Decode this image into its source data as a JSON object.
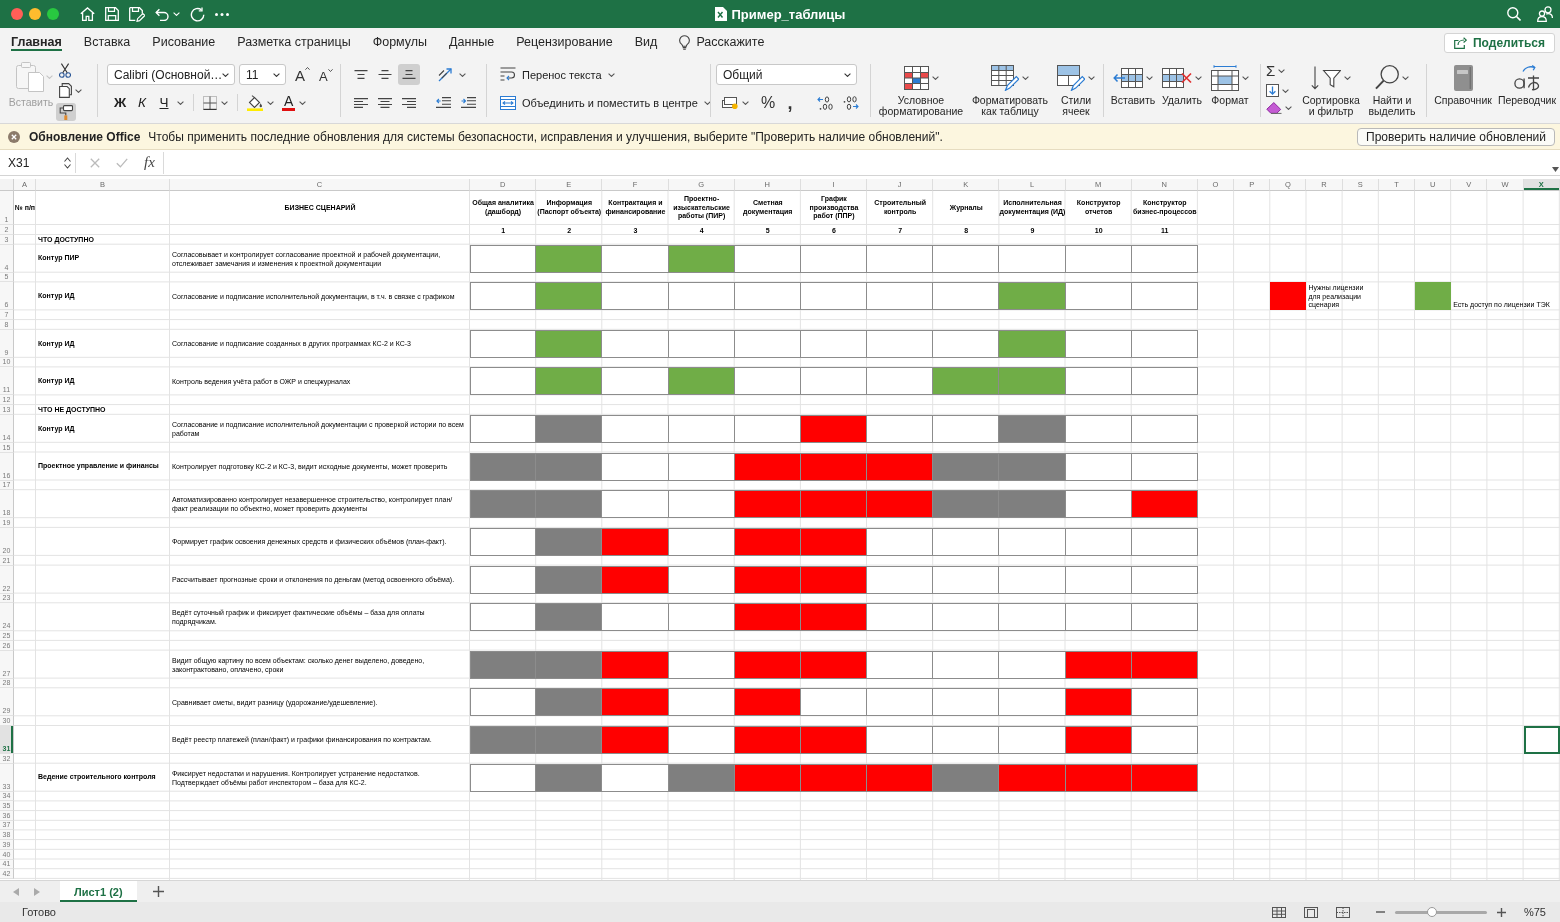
{
  "window": {
    "title": "Пример_таблицы"
  },
  "ribbon_tabs": [
    {
      "label": "Главная",
      "selected": true
    },
    {
      "label": "Вставка",
      "selected": false
    },
    {
      "label": "Рисование",
      "selected": false
    },
    {
      "label": "Разметка страницы",
      "selected": false
    },
    {
      "label": "Формулы",
      "selected": false
    },
    {
      "label": "Данные",
      "selected": false
    },
    {
      "label": "Рецензирование",
      "selected": false
    },
    {
      "label": "Вид",
      "selected": false
    }
  ],
  "tell_me": "Расскажите",
  "share_button": "Поделиться",
  "ribbon": {
    "clipboard": {
      "paste": "Вставить",
      "paste_disabled": true,
      "format_painter_on": true
    },
    "font": {
      "name": "Calibri (Основной…",
      "size": "11",
      "grow": "A",
      "shrink": "A",
      "bold": "Ж",
      "italic": "К",
      "underline": "Ч",
      "color_button": "A"
    },
    "vertical_align": [
      {
        "kind": "top",
        "selected": false
      },
      {
        "kind": "middle",
        "selected": false
      },
      {
        "kind": "bottom",
        "selected": true
      }
    ],
    "wrap_text": "Перенос текста",
    "merge": "Объединить и поместить в центре",
    "number_format": "Общий",
    "percent": "%",
    "comma": ",",
    "styles": [
      {
        "kind": "conditional",
        "label": "Условное форматирование"
      },
      {
        "kind": "table",
        "label": "Форматировать как таблицу"
      },
      {
        "kind": "cell_styles",
        "label": "Стили ячеек"
      }
    ],
    "cells": [
      {
        "kind": "insert",
        "label": "Вставить"
      },
      {
        "kind": "delete",
        "label": "Удалить"
      },
      {
        "kind": "format",
        "label": "Формат"
      }
    ],
    "autosum": "Σ",
    "editing": [
      {
        "kind": "sort",
        "label": "Сортировка и фильтр"
      },
      {
        "kind": "find",
        "label": "Найти и выделить"
      }
    ],
    "addins": [
      {
        "kind": "reference",
        "label": "Справочник"
      },
      {
        "kind": "translator",
        "label": "Переводчик"
      }
    ]
  },
  "notification": {
    "title": "Обновление Office",
    "message": "Чтобы применить последние обновления для системы безопасности, исправления и улучшения, выберите \"Проверить наличие обновлений\".",
    "button": "Проверить наличие обновлений"
  },
  "formula_bar": {
    "name_box": "X31",
    "function_button": "fx"
  },
  "sheet": {
    "columns": [
      {
        "label": "A",
        "selected": false
      },
      {
        "label": "B",
        "selected": false
      },
      {
        "label": "C",
        "selected": false
      },
      {
        "label": "D",
        "selected": false
      },
      {
        "label": "E",
        "selected": false
      },
      {
        "label": "F",
        "selected": false
      },
      {
        "label": "G",
        "selected": false
      },
      {
        "label": "H",
        "selected": false
      },
      {
        "label": "I",
        "selected": false
      },
      {
        "label": "J",
        "selected": false
      },
      {
        "label": "K",
        "selected": false
      },
      {
        "label": "L",
        "selected": false
      },
      {
        "label": "M",
        "selected": false
      },
      {
        "label": "N",
        "selected": false
      },
      {
        "label": "O",
        "selected": false
      },
      {
        "label": "P",
        "selected": false
      },
      {
        "label": "Q",
        "selected": false
      },
      {
        "label": "R",
        "selected": false
      },
      {
        "label": "S",
        "selected": false
      },
      {
        "label": "T",
        "selected": false
      },
      {
        "label": "U",
        "selected": false
      },
      {
        "label": "V",
        "selected": false
      },
      {
        "label": "W",
        "selected": false
      },
      {
        "label": "X",
        "selected": true
      }
    ],
    "rows": [
      {
        "number": "1",
        "selected": false,
        "kind": "header",
        "index_label": "№ п/п",
        "scenario_label": "БИЗНЕС СЦЕНАРИЙ",
        "modules": [
          "Общая аналитика (дашборд)",
          "Информация (Паспорт объекта)",
          "Контрактация и финансирование",
          "Проектно-изыскательские работы (ПИР)",
          "Сметная документация",
          "График производства работ (ППР)",
          "Строительный контроль",
          "Журналы",
          "Исполнительная документация (ИД)",
          "Конструктор отчетов",
          "Конструктор бизнес-процессов"
        ]
      },
      {
        "number": "2",
        "selected": false,
        "kind": "numbers",
        "modules": [
          "1",
          "2",
          "3",
          "4",
          "5",
          "6",
          "7",
          "8",
          "9",
          "10",
          "11"
        ]
      },
      {
        "number": "3",
        "selected": false,
        "kind": "section",
        "label": "ЧТО ДОСТУПНО"
      },
      {
        "number": "4",
        "selected": false,
        "kind": "scenario",
        "group": "Контур ПИР",
        "scenario": "Согласовывает и контролирует согласование проектной и рабочей документации, отслеживает замечания и изменения к проектной документации",
        "marks": [
          {
            "color": "#ffffff"
          },
          {
            "color": "#70ad47"
          },
          {
            "color": "#ffffff"
          },
          {
            "color": "#70ad47"
          },
          {
            "color": "#ffffff"
          },
          {
            "color": "#ffffff"
          },
          {
            "color": "#ffffff"
          },
          {
            "color": "#ffffff"
          },
          {
            "color": "#ffffff"
          },
          {
            "color": "#ffffff"
          },
          {
            "color": "#ffffff"
          }
        ]
      },
      {
        "number": "5",
        "selected": false,
        "kind": "spacer"
      },
      {
        "number": "6",
        "selected": false,
        "kind": "scenario",
        "group": "Контур ИД",
        "scenario": "Согласование и подписание исполнительной документации, в т.ч. в связке с графиком",
        "marks": [
          {
            "color": "#ffffff"
          },
          {
            "color": "#70ad47"
          },
          {
            "color": "#ffffff"
          },
          {
            "color": "#ffffff"
          },
          {
            "color": "#ffffff"
          },
          {
            "color": "#ffffff"
          },
          {
            "color": "#ffffff"
          },
          {
            "color": "#ffffff"
          },
          {
            "color": "#70ad47"
          },
          {
            "color": "#ffffff"
          },
          {
            "color": "#ffffff"
          }
        ],
        "legend": [
          {
            "color": "#ff0000",
            "label": "Нужны лицензии для реализации сценария"
          },
          {
            "color": "#70ad47",
            "label": "Есть доступ по лицензии ТЭК"
          }
        ]
      },
      {
        "number": "7",
        "selected": false,
        "kind": "spacer"
      },
      {
        "number": "8",
        "selected": false,
        "kind": "spacer"
      },
      {
        "number": "9",
        "selected": false,
        "kind": "scenario",
        "group": "Контур ИД",
        "scenario": "Согласование и подписание созданных в других программах КС-2 и КС-3",
        "marks": [
          {
            "color": "#ffffff"
          },
          {
            "color": "#70ad47"
          },
          {
            "color": "#ffffff"
          },
          {
            "color": "#ffffff"
          },
          {
            "color": "#ffffff"
          },
          {
            "color": "#ffffff"
          },
          {
            "color": "#ffffff"
          },
          {
            "color": "#ffffff"
          },
          {
            "color": "#70ad47"
          },
          {
            "color": "#ffffff"
          },
          {
            "color": "#ffffff"
          }
        ]
      },
      {
        "number": "10",
        "selected": false,
        "kind": "spacer"
      },
      {
        "number": "11",
        "selected": false,
        "kind": "scenario",
        "group": "Контур ИД",
        "scenario": "Контроль ведения учёта работ в ОЖР и спецжурналах",
        "marks": [
          {
            "color": "#ffffff"
          },
          {
            "color": "#70ad47"
          },
          {
            "color": "#ffffff"
          },
          {
            "color": "#70ad47"
          },
          {
            "color": "#ffffff"
          },
          {
            "color": "#ffffff"
          },
          {
            "color": "#ffffff"
          },
          {
            "color": "#70ad47"
          },
          {
            "color": "#70ad47"
          },
          {
            "color": "#ffffff"
          },
          {
            "color": "#ffffff"
          }
        ]
      },
      {
        "number": "12",
        "selected": false,
        "kind": "spacer"
      },
      {
        "number": "13",
        "selected": false,
        "kind": "section",
        "label": "ЧТО НЕ ДОСТУПНО"
      },
      {
        "number": "14",
        "selected": false,
        "kind": "scenario",
        "group": "Контур ИД",
        "scenario": "Согласование и подписание исполнительной документации с проверкой истории по всем работам",
        "marks": [
          {
            "color": "#ffffff"
          },
          {
            "color": "#7f7f7f"
          },
          {
            "color": "#ffffff"
          },
          {
            "color": "#ffffff"
          },
          {
            "color": "#ffffff"
          },
          {
            "color": "#ff0000"
          },
          {
            "color": "#ffffff"
          },
          {
            "color": "#ffffff"
          },
          {
            "color": "#7f7f7f"
          },
          {
            "color": "#ffffff"
          },
          {
            "color": "#ffffff"
          }
        ]
      },
      {
        "number": "15",
        "selected": false,
        "kind": "spacer"
      },
      {
        "number": "16",
        "selected": false,
        "kind": "scenario",
        "group": "Проектное управление и финансы",
        "scenario": "Контролирует подготовку КС-2 и КС-3, видит исходные документы, может проверить",
        "marks": [
          {
            "color": "#7f7f7f"
          },
          {
            "color": "#7f7f7f"
          },
          {
            "color": "#ffffff"
          },
          {
            "color": "#ffffff"
          },
          {
            "color": "#ff0000"
          },
          {
            "color": "#ff0000"
          },
          {
            "color": "#ff0000"
          },
          {
            "color": "#7f7f7f"
          },
          {
            "color": "#7f7f7f"
          },
          {
            "color": "#ffffff"
          },
          {
            "color": "#ffffff"
          }
        ]
      },
      {
        "number": "17",
        "selected": false,
        "kind": "spacer"
      },
      {
        "number": "18",
        "selected": false,
        "kind": "scenario",
        "scenario": "Автоматизированно контролирует незавершенное строительство, контролирует план/факт реализации по объектно, может проверить документы",
        "marks": [
          {
            "color": "#7f7f7f"
          },
          {
            "color": "#7f7f7f"
          },
          {
            "color": "#ffffff"
          },
          {
            "color": "#ffffff"
          },
          {
            "color": "#ff0000"
          },
          {
            "color": "#ff0000"
          },
          {
            "color": "#ff0000"
          },
          {
            "color": "#7f7f7f"
          },
          {
            "color": "#7f7f7f"
          },
          {
            "color": "#ffffff"
          },
          {
            "color": "#ff0000"
          }
        ]
      },
      {
        "number": "19",
        "selected": false,
        "kind": "spacer"
      },
      {
        "number": "20",
        "selected": false,
        "kind": "scenario",
        "scenario": "Формирует график освоения денежных средств и физических объёмов (план-факт).",
        "marks": [
          {
            "color": "#ffffff"
          },
          {
            "color": "#7f7f7f"
          },
          {
            "color": "#ff0000"
          },
          {
            "color": "#ffffff"
          },
          {
            "color": "#ff0000"
          },
          {
            "color": "#ff0000"
          },
          {
            "color": "#ffffff"
          },
          {
            "color": "#ffffff"
          },
          {
            "color": "#ffffff"
          },
          {
            "color": "#ffffff"
          },
          {
            "color": "#ffffff"
          }
        ]
      },
      {
        "number": "21",
        "selected": false,
        "kind": "spacer"
      },
      {
        "number": "22",
        "selected": false,
        "kind": "scenario",
        "scenario": "Рассчитывает прогнозные сроки и отклонения по деньгам (метод освоенного объёма).",
        "marks": [
          {
            "color": "#ffffff"
          },
          {
            "color": "#7f7f7f"
          },
          {
            "color": "#ff0000"
          },
          {
            "color": "#ffffff"
          },
          {
            "color": "#ff0000"
          },
          {
            "color": "#ff0000"
          },
          {
            "color": "#ffffff"
          },
          {
            "color": "#ffffff"
          },
          {
            "color": "#ffffff"
          },
          {
            "color": "#ffffff"
          },
          {
            "color": "#ffffff"
          }
        ]
      },
      {
        "number": "23",
        "selected": false,
        "kind": "spacer"
      },
      {
        "number": "24",
        "selected": false,
        "kind": "scenario",
        "scenario": "Ведёт суточный график и фиксирует фактические объёмы – база для оплаты подрядчикам.",
        "marks": [
          {
            "color": "#ffffff"
          },
          {
            "color": "#7f7f7f"
          },
          {
            "color": "#ffffff"
          },
          {
            "color": "#ffffff"
          },
          {
            "color": "#ff0000"
          },
          {
            "color": "#ff0000"
          },
          {
            "color": "#ffffff"
          },
          {
            "color": "#ffffff"
          },
          {
            "color": "#ffffff"
          },
          {
            "color": "#ffffff"
          },
          {
            "color": "#ffffff"
          }
        ]
      },
      {
        "number": "25",
        "selected": false,
        "kind": "spacer"
      },
      {
        "number": "26",
        "selected": false,
        "kind": "spacer"
      },
      {
        "number": "27",
        "selected": false,
        "kind": "scenario",
        "scenario": "Видит общую картину по всем объектам: сколько денег выделено, доведено, законтрактовано, оплачено, сроки",
        "marks": [
          {
            "color": "#7f7f7f"
          },
          {
            "color": "#7f7f7f"
          },
          {
            "color": "#ff0000"
          },
          {
            "color": "#ffffff"
          },
          {
            "color": "#ff0000"
          },
          {
            "color": "#ff0000"
          },
          {
            "color": "#ffffff"
          },
          {
            "color": "#ffffff"
          },
          {
            "color": "#ffffff"
          },
          {
            "color": "#ff0000"
          },
          {
            "color": "#ff0000"
          }
        ]
      },
      {
        "number": "28",
        "selected": false,
        "kind": "spacer"
      },
      {
        "number": "29",
        "selected": false,
        "kind": "scenario",
        "scenario": "Сравнивает сметы, видит разницу (удорожание/удешевление).",
        "marks": [
          {
            "color": "#ffffff"
          },
          {
            "color": "#7f7f7f"
          },
          {
            "color": "#ff0000"
          },
          {
            "color": "#ffffff"
          },
          {
            "color": "#ff0000"
          },
          {
            "color": "#ffffff"
          },
          {
            "color": "#ffffff"
          },
          {
            "color": "#ffffff"
          },
          {
            "color": "#ffffff"
          },
          {
            "color": "#ff0000"
          },
          {
            "color": "#ffffff"
          }
        ]
      },
      {
        "number": "30",
        "selected": false,
        "kind": "spacer"
      },
      {
        "number": "31",
        "selected": true,
        "kind": "scenario",
        "scenario": "Ведёт реестр платежей (план/факт) и графики финансирования по контрактам.",
        "marks": [
          {
            "color": "#7f7f7f"
          },
          {
            "color": "#7f7f7f"
          },
          {
            "color": "#ff0000"
          },
          {
            "color": "#ffffff"
          },
          {
            "color": "#ff0000"
          },
          {
            "color": "#ff0000"
          },
          {
            "color": "#ffffff"
          },
          {
            "color": "#ffffff"
          },
          {
            "color": "#ffffff"
          },
          {
            "color": "#ff0000"
          },
          {
            "color": "#ffffff"
          }
        ]
      },
      {
        "number": "32",
        "selected": false,
        "kind": "spacer"
      },
      {
        "number": "33",
        "selected": false,
        "kind": "scenario",
        "group": "Ведение строительного контроля",
        "scenario": "Фиксирует недостатки и нарушения. Контролирует устранение недостатков. Подтверждает объёмы работ инспектором – база для КС-2.",
        "marks": [
          {
            "color": "#ffffff"
          },
          {
            "color": "#7f7f7f"
          },
          {
            "color": "#ffffff"
          },
          {
            "color": "#7f7f7f"
          },
          {
            "color": "#ff0000"
          },
          {
            "color": "#ff0000"
          },
          {
            "color": "#ff0000"
          },
          {
            "color": "#7f7f7f"
          },
          {
            "color": "#ff0000"
          },
          {
            "color": "#ff0000"
          },
          {
            "color": "#ff0000"
          }
        ]
      },
      {
        "number": "34",
        "selected": false,
        "kind": "spacer"
      },
      {
        "number": "35",
        "selected": false,
        "kind": "spacer"
      },
      {
        "number": "36",
        "selected": false,
        "kind": "spacer"
      },
      {
        "number": "37",
        "selected": false,
        "kind": "spacer"
      },
      {
        "number": "38",
        "selected": false,
        "kind": "spacer"
      },
      {
        "number": "39",
        "selected": false,
        "kind": "spacer"
      },
      {
        "number": "40",
        "selected": false,
        "kind": "spacer"
      },
      {
        "number": "41",
        "selected": false,
        "kind": "spacer"
      },
      {
        "number": "42",
        "selected": false,
        "kind": "spacer"
      }
    ]
  },
  "sheet_tabs": [
    {
      "label": "Лист1 (2)",
      "selected": true
    }
  ],
  "status_bar": {
    "status": "Готово",
    "zoom": {
      "level": 0.4,
      "reading": "%75"
    }
  }
}
